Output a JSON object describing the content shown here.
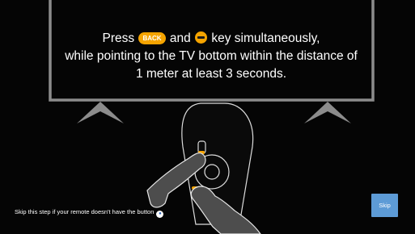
{
  "instruction": {
    "line1_prefix": "Press",
    "back_key_label": "BACK",
    "line1_middle": "and",
    "line1_suffix": "key simultaneously,",
    "line2": "while pointing to the TV bottom within the distance of",
    "line3": "1 meter at least 3 seconds."
  },
  "skip_note": {
    "text": "Skip this step if your remote doesn't have the button",
    "icon": "voice-icon"
  },
  "skip_button": {
    "label": "Skip"
  },
  "colors": {
    "background": "#050505",
    "tv_frame": "#8c8c8c",
    "key_accent": "#f5a400",
    "skip_button": "#5d9bd6",
    "text": "#ffffff"
  }
}
